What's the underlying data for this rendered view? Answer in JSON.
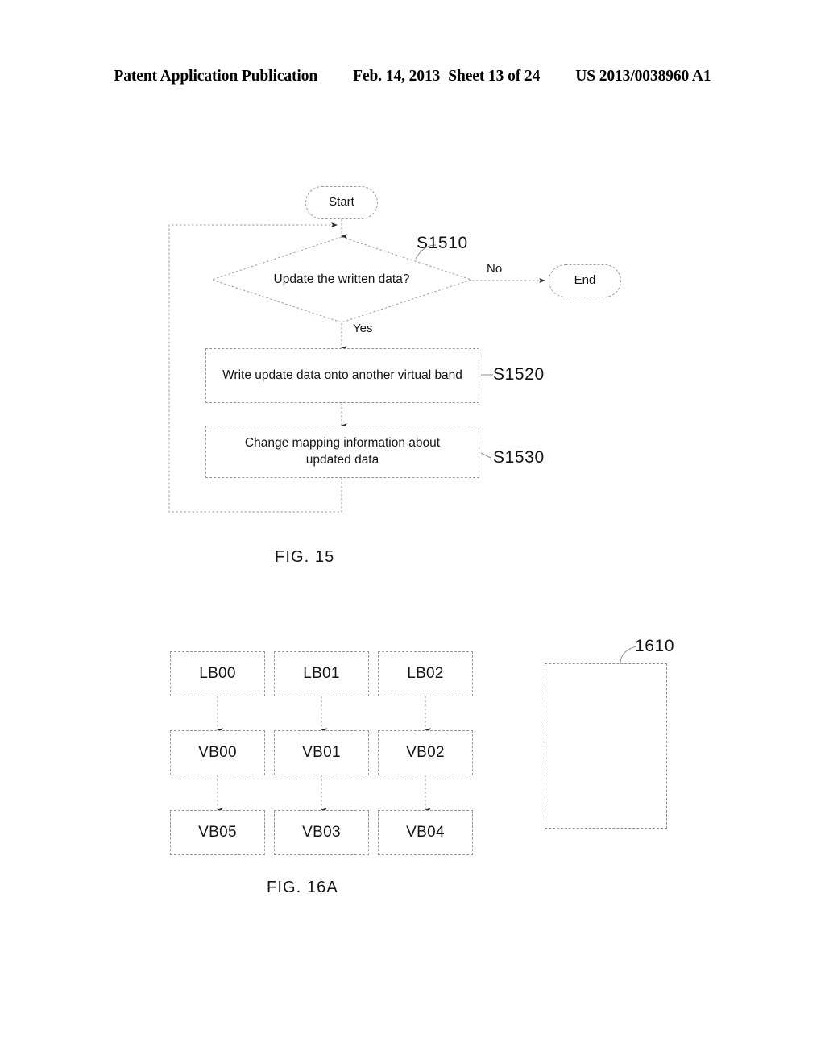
{
  "header": {
    "publication": "Patent Application Publication",
    "date": "Feb. 14, 2013",
    "sheet": "Sheet 13 of 24",
    "document_number": "US 2013/0038960 A1"
  },
  "figures": [
    {
      "id": "fig15",
      "caption": "FIG. 15",
      "type": "flowchart",
      "nodes": {
        "start": "Start",
        "decision": "Update the written data?",
        "end": "End",
        "step1": "Write update data onto another virtual band",
        "step2_line1": "Change mapping information about",
        "step2_line2": "updated data"
      },
      "edge_labels": {
        "no": "No",
        "yes": "Yes"
      },
      "reference_numerals": {
        "decision": "S1510",
        "step1": "S1520",
        "step2": "S1530"
      }
    },
    {
      "id": "fig16a",
      "caption": "FIG. 16A",
      "type": "block-mapping",
      "grid": [
        [
          "LB00",
          "LB01",
          "LB02"
        ],
        [
          "VB00",
          "VB01",
          "VB02"
        ],
        [
          "VB05",
          "VB03",
          "VB04"
        ]
      ],
      "region_label": "1610"
    }
  ]
}
